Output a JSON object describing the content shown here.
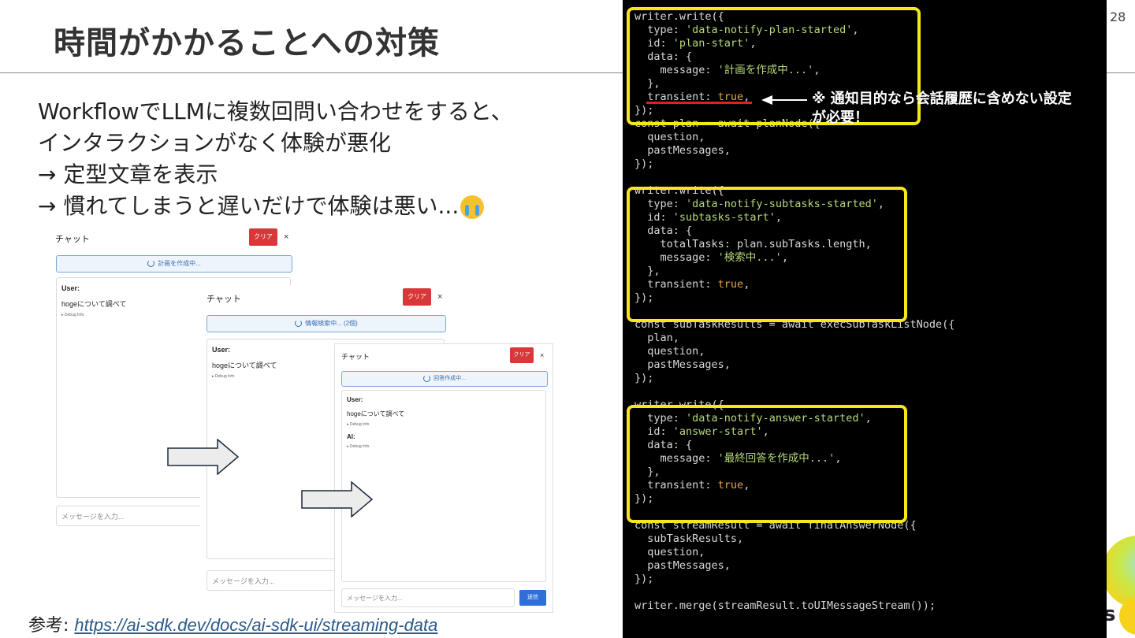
{
  "slide": {
    "title": "時間がかかることへの対策",
    "page_number": "28",
    "bullets": [
      "WorkflowでLLMに複数回問い合わせをすると、",
      "インタラクションがなく体験が悪化",
      "→ 定型文章を表示",
      "→ 慣れてしまうと遅いだけで体験は悪い..."
    ],
    "emoji": "loudly-crying-face",
    "reference_label": "参考: ",
    "reference_url": "https://ai-sdk.dev/docs/ai-sdk-ui/streaming-data"
  },
  "chats": [
    {
      "header": "チャット",
      "clear": "クリア",
      "close": "×",
      "status": "計画を作成中...",
      "user_label": "User:",
      "user_text": "hogeについて調べて",
      "debug": "▸ Debug Info",
      "input_placeholder": "メッセージを入力..."
    },
    {
      "header": "チャット",
      "clear": "クリア",
      "close": "×",
      "status": "情報検索中... (2個)",
      "user_label": "User:",
      "user_text": "hogeについて調べて",
      "debug": "▸ Debug Info",
      "input_placeholder": "メッセージを入力..."
    },
    {
      "header": "チャット",
      "clear": "クリア",
      "close": "×",
      "status": "回答作成中...",
      "user_label": "User:",
      "user_text": "hogeについて調べて",
      "debug": "▸ Debug Info",
      "ai_label": "AI:",
      "ai_debug": "▸ Debug Info",
      "input_placeholder": "メッセージを入力...",
      "send": "送信"
    }
  ],
  "code_note": {
    "line1": "※ 通知目的なら会話履歴に含めない設定",
    "line2": "が必要！"
  },
  "code_lines": [
    "writer.write({",
    "  type: 'data-notify-plan-started',",
    "  id: 'plan-start',",
    "  data: {",
    "    message: '計画を作成中...',",
    "  },",
    "  transient: true,",
    "});",
    "const plan = await planNode({",
    "  question,",
    "  pastMessages,",
    "});",
    "",
    "writer.write({",
    "  type: 'data-notify-subtasks-started',",
    "  id: 'subtasks-start',",
    "  data: {",
    "    totalTasks: plan.subTasks.length,",
    "    message: '検索中...',",
    "  },",
    "  transient: true,",
    "});",
    "",
    "const subTaskResults = await execSubTaskListNode({",
    "  plan,",
    "  question,",
    "  pastMessages,",
    "});",
    "",
    "writer.write({",
    "  type: 'data-notify-answer-started',",
    "  id: 'answer-start',",
    "  data: {",
    "    message: '最終回答を作成中...',",
    "  },",
    "  transient: true,",
    "});",
    "",
    "const streamResult = await finalAnswerNode({",
    "  subTaskResults,",
    "  question,",
    "  pastMessages,",
    "});",
    "",
    "writer.merge(streamResult.toUIMessageStream());"
  ],
  "colors": {
    "code_bg": "#000000",
    "highlight": "#f5e71a",
    "string": "#b6d97a",
    "keyword": "#e8a04c",
    "underline": "#e02020",
    "clear_button": "#d9383a",
    "send_button": "#2f6fd6"
  }
}
